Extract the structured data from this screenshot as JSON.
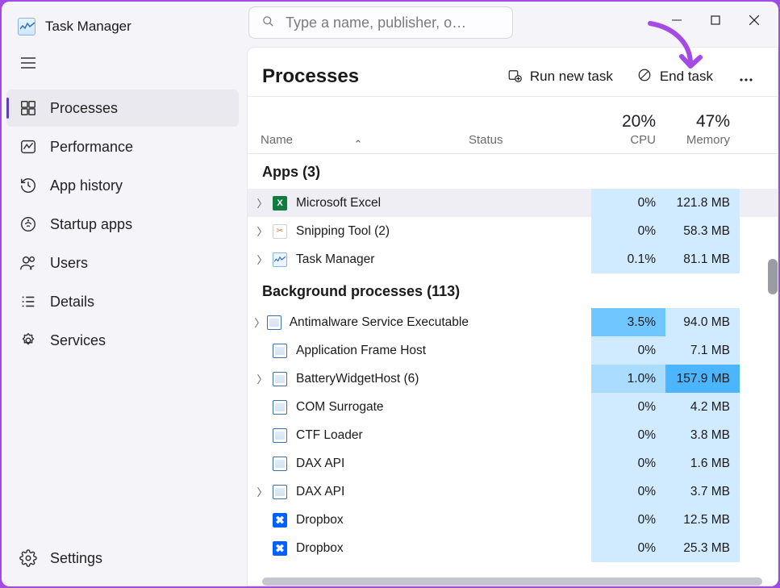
{
  "app": {
    "title": "Task Manager"
  },
  "search": {
    "placeholder": "Type a name, publisher, o…"
  },
  "sidebar": {
    "items": [
      {
        "icon": "processes-icon",
        "label": "Processes",
        "active": true
      },
      {
        "icon": "performance-icon",
        "label": "Performance",
        "active": false
      },
      {
        "icon": "history-icon",
        "label": "App history",
        "active": false
      },
      {
        "icon": "startup-icon",
        "label": "Startup apps",
        "active": false
      },
      {
        "icon": "users-icon",
        "label": "Users",
        "active": false
      },
      {
        "icon": "details-icon",
        "label": "Details",
        "active": false
      },
      {
        "icon": "services-icon",
        "label": "Services",
        "active": false
      }
    ],
    "settings_label": "Settings"
  },
  "toolbar": {
    "title": "Processes",
    "run_label": "Run new task",
    "end_label": "End task"
  },
  "columns": {
    "name": "Name",
    "status": "Status",
    "cpu_label": "CPU",
    "mem_label": "Memory",
    "cpu_total": "20%",
    "mem_total": "47%"
  },
  "groups": [
    {
      "title": "Apps (3)",
      "rows": [
        {
          "expand": true,
          "icon": "excel",
          "name": "Microsoft Excel",
          "cpu": "0%",
          "mem": "121.8 MB",
          "cpu_heat": 0,
          "mem_heat": 0,
          "selected": true
        },
        {
          "expand": true,
          "icon": "snip",
          "name": "Snipping Tool (2)",
          "cpu": "0%",
          "mem": "58.3 MB",
          "cpu_heat": 0,
          "mem_heat": 0
        },
        {
          "expand": true,
          "icon": "tm",
          "name": "Task Manager",
          "cpu": "0.1%",
          "mem": "81.1 MB",
          "cpu_heat": 0,
          "mem_heat": 0
        }
      ]
    },
    {
      "title": "Background processes (113)",
      "rows": [
        {
          "expand": true,
          "icon": "app",
          "name": "Antimalware Service Executable",
          "cpu": "3.5%",
          "mem": "94.0 MB",
          "cpu_heat": 2,
          "mem_heat": 0
        },
        {
          "expand": false,
          "icon": "app",
          "name": "Application Frame Host",
          "cpu": "0%",
          "mem": "7.1 MB",
          "cpu_heat": 0,
          "mem_heat": 0
        },
        {
          "expand": true,
          "icon": "app",
          "name": "BatteryWidgetHost (6)",
          "cpu": "1.0%",
          "mem": "157.9 MB",
          "cpu_heat": 1,
          "mem_heat": 3
        },
        {
          "expand": false,
          "icon": "app",
          "name": "COM Surrogate",
          "cpu": "0%",
          "mem": "4.2 MB",
          "cpu_heat": 0,
          "mem_heat": 0
        },
        {
          "expand": false,
          "icon": "app",
          "name": "CTF Loader",
          "cpu": "0%",
          "mem": "3.8 MB",
          "cpu_heat": 0,
          "mem_heat": 0
        },
        {
          "expand": false,
          "icon": "app",
          "name": "DAX API",
          "cpu": "0%",
          "mem": "1.6 MB",
          "cpu_heat": 0,
          "mem_heat": 0
        },
        {
          "expand": true,
          "icon": "app",
          "name": "DAX API",
          "cpu": "0%",
          "mem": "3.7 MB",
          "cpu_heat": 0,
          "mem_heat": 0
        },
        {
          "expand": false,
          "icon": "dropbox",
          "name": "Dropbox",
          "cpu": "0%",
          "mem": "12.5 MB",
          "cpu_heat": 0,
          "mem_heat": 0
        },
        {
          "expand": false,
          "icon": "dropbox",
          "name": "Dropbox",
          "cpu": "0%",
          "mem": "25.3 MB",
          "cpu_heat": 0,
          "mem_heat": 0
        }
      ]
    }
  ],
  "annotation_arrow_color": "#a24be5"
}
